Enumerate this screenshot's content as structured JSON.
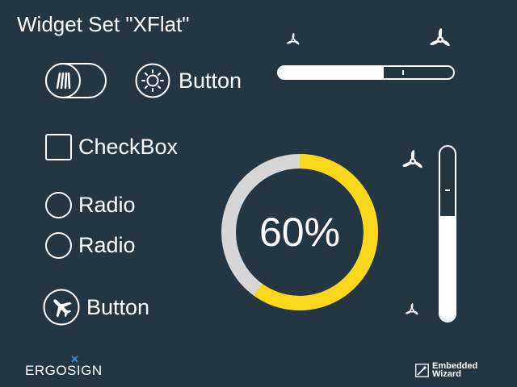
{
  "title": "Widget Set \"XFlat\"",
  "toggle": {
    "icon": "lines-icon",
    "state": "off"
  },
  "icon_button": {
    "label": "Button",
    "icon": "sun-icon"
  },
  "checkbox": {
    "label": "CheckBox",
    "checked": false
  },
  "radios": [
    {
      "label": "Radio",
      "selected": false
    },
    {
      "label": "Radio",
      "selected": false
    }
  ],
  "plane_button": {
    "label": "Button",
    "icon": "airplane-icon"
  },
  "h_slider": {
    "value": 0.6,
    "icons": [
      "fan-small-icon",
      "fan-large-icon"
    ]
  },
  "v_slider": {
    "value": 0.6,
    "icons": [
      "fan-large-icon",
      "fan-small-icon"
    ]
  },
  "gauge": {
    "value": 60,
    "text": "60%",
    "colors": {
      "track": "#d6d6d6",
      "value": "#f9d71c"
    }
  },
  "logos": {
    "ergosign": "ERGOSIGN",
    "embedded_wizard_line1": "Embedded",
    "embedded_wizard_line2": "Wizard"
  },
  "colors": {
    "background": "#243642",
    "accent": "#f9d71c",
    "foreground": "#ffffff",
    "logo_x": "#1d9be2"
  }
}
